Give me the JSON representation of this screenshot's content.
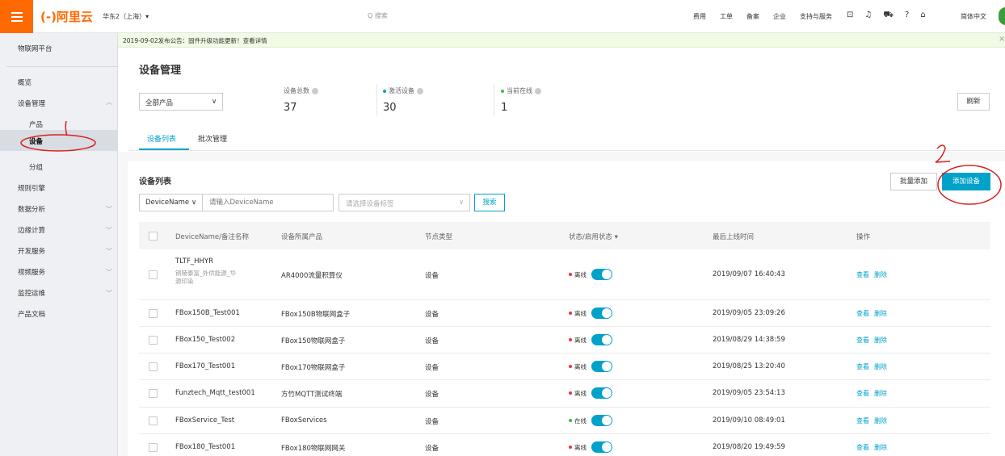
{
  "topbar": {
    "logo": "(-)阿里云",
    "region": "华东2（上海）▾",
    "search_placeholder": "Q 搜索",
    "links": [
      "费用",
      "工单",
      "备案",
      "企业",
      "支持与服务"
    ],
    "language": "简体中文"
  },
  "sidebar": {
    "platform_title": "物联网平台",
    "items": [
      {
        "label": "概览"
      },
      {
        "label": "设备管理"
      },
      {
        "label": "产品"
      },
      {
        "label": "设备"
      },
      {
        "label": "分组"
      },
      {
        "label": "规则引擎"
      },
      {
        "label": "数据分析"
      },
      {
        "label": "边缘计算"
      },
      {
        "label": "开发服务"
      },
      {
        "label": "视频服务"
      },
      {
        "label": "监控运维"
      },
      {
        "label": "产品文档"
      }
    ]
  },
  "notice": {
    "text": "2019-09-02发布公告：固件升级功能更新！查看详情",
    "close": "×"
  },
  "page": {
    "title": "设备管理",
    "product_select": "全部产品",
    "refresh": "刷新",
    "stats": [
      {
        "label": "设备总数",
        "value": "37"
      },
      {
        "label": "激活设备",
        "value": "30"
      },
      {
        "label": "当前在线",
        "value": "1"
      }
    ],
    "tabs": [
      "设备列表",
      "批次管理"
    ]
  },
  "list": {
    "title": "设备列表",
    "batch_add": "批量添加",
    "add_device": "添加设备",
    "filter_type": "DeviceName",
    "filter_placeholder": "请输入DeviceName",
    "tags_placeholder": "请选择设备标签",
    "search": "搜索",
    "columns": [
      "DeviceName/备注名称",
      "设备所属产品",
      "节点类型",
      "状态/启用状态",
      "最后上线时间",
      "操作"
    ],
    "view": "查看",
    "delete": "删除",
    "rows": [
      {
        "name": "TLTF_HHYR",
        "note": "铜陵泰富_外供能源_华源印染",
        "product": "AR4000流量积算仪",
        "node": "设备",
        "status": "离线",
        "time": "2019/09/07 16:40:43"
      },
      {
        "name": "FBox150B_Test001",
        "product": "FBox150B物联网盒子",
        "node": "设备",
        "status": "离线",
        "time": "2019/09/05 23:09:26"
      },
      {
        "name": "FBox150_Test002",
        "product": "FBox150物联网盒子",
        "node": "设备",
        "status": "离线",
        "time": "2019/08/29 14:38:59"
      },
      {
        "name": "FBox170_Test001",
        "product": "FBox170物联网盒子",
        "node": "设备",
        "status": "离线",
        "time": "2019/08/25 13:20:40"
      },
      {
        "name": "Funztech_Mqtt_test001",
        "product": "方竹MQTT测试终端",
        "node": "设备",
        "status": "离线",
        "time": "2019/09/05 23:54:13"
      },
      {
        "name": "FBoxService_Test",
        "product": "FBoxServices",
        "node": "设备",
        "status": "在线",
        "time": "2019/09/10 08:49:01"
      },
      {
        "name": "FBox180_Test001",
        "product": "FBox180物联网网关",
        "node": "设备",
        "status": "离线",
        "time": "2019/08/20 19:49:59"
      }
    ]
  },
  "annotations": {
    "one": "1",
    "two": "2"
  },
  "colors": {
    "accent": "#00a2ca",
    "brand": "#ff6a00",
    "offline": "#e8353e",
    "online": "#3dbb3d",
    "annotation": "#d9201f"
  }
}
